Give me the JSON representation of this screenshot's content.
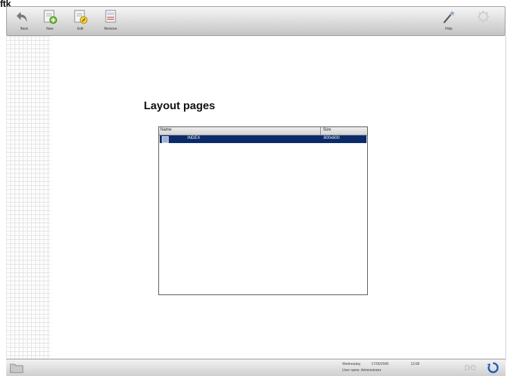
{
  "corner_label": "ftk",
  "toolbar": {
    "buttons": [
      {
        "label": "Back",
        "icon": "back-arrow-icon"
      },
      {
        "label": "New",
        "icon": "new-page-icon"
      },
      {
        "label": "Edit",
        "icon": "edit-page-icon"
      },
      {
        "label": "Remove",
        "icon": "remove-page-icon"
      }
    ],
    "right_buttons": [
      {
        "label": "Help",
        "icon": "magic-wand-icon"
      },
      {
        "label": "",
        "icon": "settings-icon"
      }
    ]
  },
  "main": {
    "title": "Layout pages",
    "list": {
      "columns": [
        "Name",
        "Size"
      ],
      "rows": [
        {
          "name": "INDEX",
          "size": "800x600",
          "selected": true
        }
      ]
    }
  },
  "status": {
    "day": "Wednesday",
    "date": "17/05/2006",
    "time": "13:58",
    "user_line": "User name: Administrator"
  }
}
